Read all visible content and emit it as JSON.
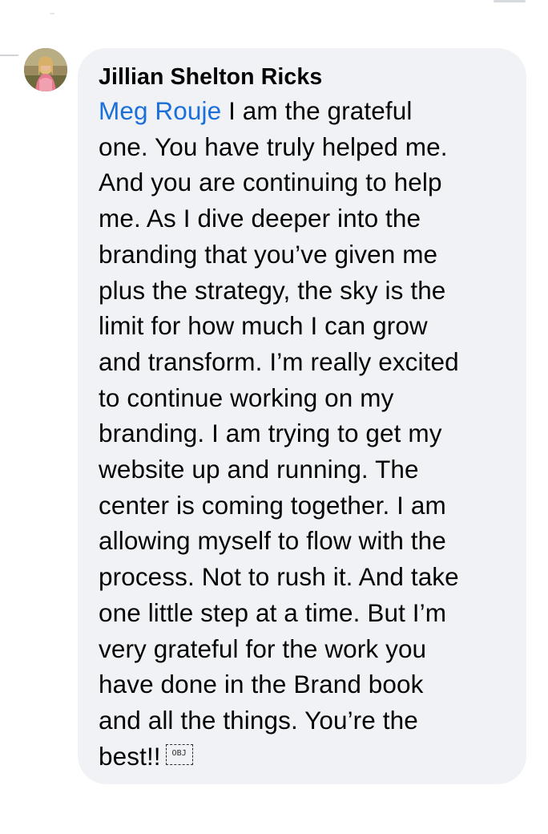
{
  "comment": {
    "author": "Jillian Shelton Ricks",
    "mention": "Meg Rouje",
    "body_lines": [
      "I am the grateful",
      "one. You have truly helped me.",
      "And you are continuing to help",
      "me. As I dive deeper into the",
      "branding that you’ve given me",
      "plus the strategy, the sky is the",
      "limit for how much I can grow",
      "and transform. I’m really excited",
      "to continue working on my",
      "branding. I am trying to get my",
      "website up and running. The",
      "center is coming together. I am",
      "allowing myself to flow with the",
      "process. Not to rush it. And take",
      "one little step at a time. But I’m",
      "very grateful for the work you",
      "have done in the Brand book",
      "and all the things. You’re the",
      "best!!"
    ],
    "object_glyph": "OBJ"
  },
  "colors": {
    "bubble_background": "#f0f2f5",
    "mention": "#1b6fd9",
    "text": "#050505"
  },
  "icons": {
    "avatar": "user-avatar-photo",
    "object_placeholder": "object-replacement-glyph"
  }
}
